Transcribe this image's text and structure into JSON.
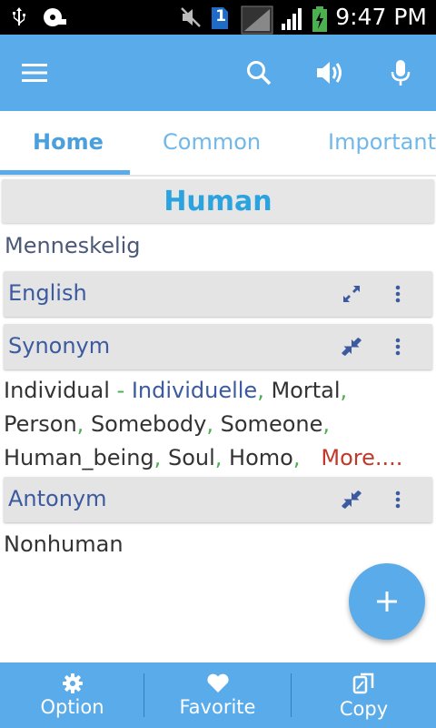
{
  "status_bar": {
    "time": "9:47 PM",
    "sim_badge": "1",
    "icons": [
      "usb-icon",
      "media-icon",
      "mute-icon",
      "sim-icon",
      "signal-icon",
      "signal-bars-icon",
      "battery-charging-icon"
    ]
  },
  "app_bar": {
    "icons": [
      "menu-icon",
      "search-icon",
      "speaker-icon",
      "mic-icon"
    ]
  },
  "tabs": [
    {
      "label": "Home",
      "active": true
    },
    {
      "label": "Common",
      "active": false
    },
    {
      "label": "Important",
      "active": false
    }
  ],
  "word": {
    "title": "Human",
    "translation": "Menneskelig"
  },
  "sections": {
    "english": {
      "label": "English",
      "icon": "expand-icon"
    },
    "synonym": {
      "label": "Synonym",
      "icon": "collapse-icon"
    },
    "antonym": {
      "label": "Antonym",
      "icon": "collapse-icon"
    }
  },
  "synonyms": {
    "first": "Individual",
    "dash": " - ",
    "first_translation": "Individuelle",
    "items": [
      "Mortal",
      "Person",
      "Somebody",
      "Someone",
      "Human_being",
      "Soul",
      "Homo"
    ],
    "separator": ",",
    "more_label": "More...."
  },
  "antonyms": {
    "text": "Nonhuman"
  },
  "fab": {
    "icon": "plus-icon"
  },
  "bottom_bar": {
    "option_label": "Option",
    "favorite_label": "Favorite",
    "copy_label": "Copy"
  },
  "colors": {
    "primary": "#5aabea",
    "title": "#2aa3de",
    "section_text": "#3c5aa0",
    "separator": "#4caf50",
    "more": "#c0392b"
  }
}
